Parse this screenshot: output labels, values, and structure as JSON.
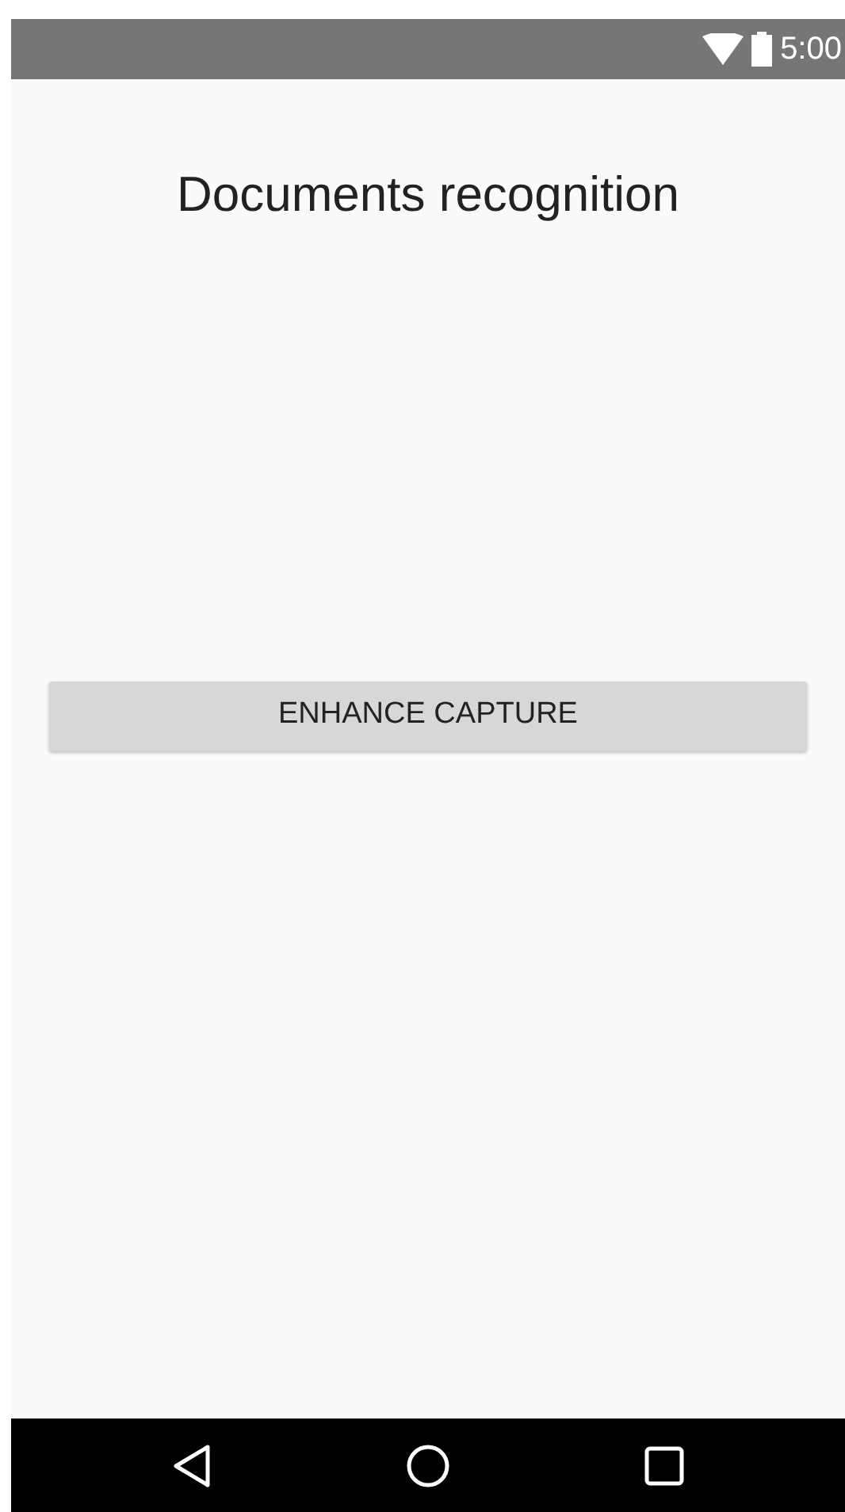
{
  "status_bar": {
    "time": "5:00"
  },
  "title": "Documents recognition",
  "button": {
    "label": "ENHANCE CAPTURE"
  }
}
